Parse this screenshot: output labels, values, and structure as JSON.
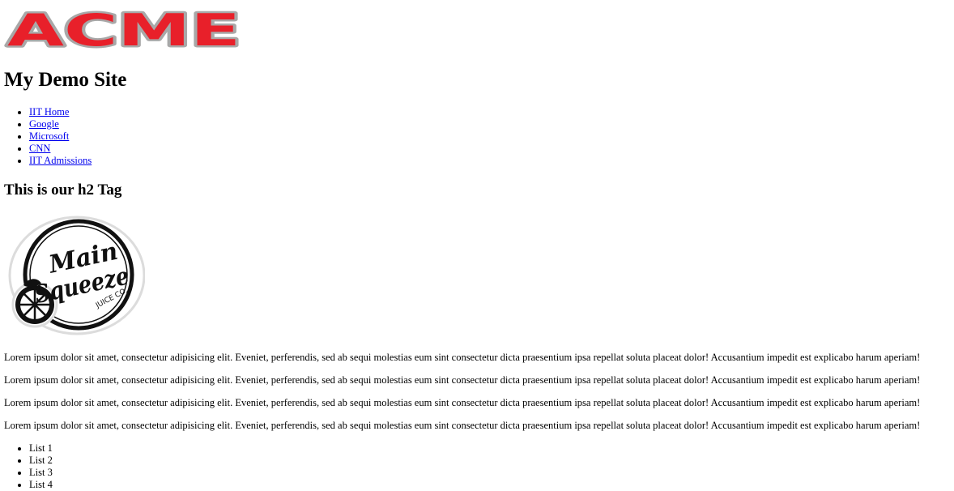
{
  "logo": {
    "text": "ACME",
    "fill_color": "#e8202a",
    "outline_color": "#a8a8a8"
  },
  "site_title": "My Demo Site",
  "nav_links": [
    {
      "label": "IIT Home"
    },
    {
      "label": "Google"
    },
    {
      "label": "Microsoft"
    },
    {
      "label": "CNN"
    },
    {
      "label": "IIT Admissions"
    }
  ],
  "h2_heading": "This is our h2 Tag",
  "badge": {
    "line1": "Main",
    "line2": "Squeeze",
    "line3": "JUICE CO."
  },
  "paragraphs": [
    "Lorem ipsum dolor sit amet, consectetur adipisicing elit. Eveniet, perferendis, sed ab sequi molestias eum sint consectetur dicta praesentium ipsa repellat soluta placeat dolor! Accusantium impedit est explicabo harum aperiam!",
    "Lorem ipsum dolor sit amet, consectetur adipisicing elit. Eveniet, perferendis, sed ab sequi molestias eum sint consectetur dicta praesentium ipsa repellat soluta placeat dolor! Accusantium impedit est explicabo harum aperiam!",
    "Lorem ipsum dolor sit amet, consectetur adipisicing elit. Eveniet, perferendis, sed ab sequi molestias eum sint consectetur dicta praesentium ipsa repellat soluta placeat dolor! Accusantium impedit est explicabo harum aperiam!",
    "Lorem ipsum dolor sit amet, consectetur adipisicing elit. Eveniet, perferendis, sed ab sequi molestias eum sint consectetur dicta praesentium ipsa repellat soluta placeat dolor! Accusantium impedit est explicabo harum aperiam!"
  ],
  "list_items": [
    "List 1",
    "List 2",
    "List 3",
    "List 4"
  ]
}
